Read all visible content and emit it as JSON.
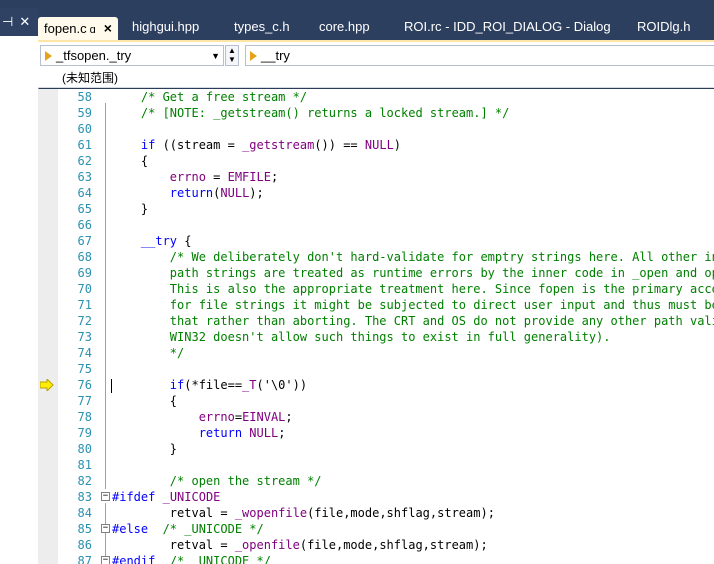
{
  "window": {
    "pin_glyph": "⊣",
    "close_glyph": "✕"
  },
  "tabs": [
    {
      "label": "fopen.c",
      "active": true
    },
    {
      "label": "highgui.hpp"
    },
    {
      "label": "types_c.h"
    },
    {
      "label": "core.hpp"
    },
    {
      "label": "ROI.rc - IDD_ROI_DIALOG - Dialog"
    },
    {
      "label": "ROIDlg.h"
    }
  ],
  "active_tab_close": "×",
  "active_tab_modified": "ɑ",
  "navigation": {
    "scope_combo": "_tfsopen._try",
    "member_combo": "__try"
  },
  "scope_label": "(未知范围)",
  "code_lines": [
    {
      "n": "58",
      "html": "    <span class='c'>/* Get a free stream */</span>"
    },
    {
      "n": "59",
      "html": "    <span class='c'>/* [NOTE: _getstream() returns a locked stream.] */</span>"
    },
    {
      "n": "60",
      "html": ""
    },
    {
      "n": "61",
      "html": "    <span class='k'>if</span> ((stream = <span class='p'>_getstream</span>()) == <span class='p'>NULL</span>)"
    },
    {
      "n": "62",
      "html": "    {"
    },
    {
      "n": "63",
      "html": "        <span class='p'>errno</span> = <span class='p'>EMFILE</span>;"
    },
    {
      "n": "64",
      "html": "        <span class='k'>return</span>(<span class='p'>NULL</span>);"
    },
    {
      "n": "65",
      "html": "    }"
    },
    {
      "n": "66",
      "html": ""
    },
    {
      "n": "67",
      "html": "    <span class='k'>__try</span> {"
    },
    {
      "n": "68",
      "html": "        <span class='c'>/* We deliberately don't hard-validate for emptry strings here. All other inva</span>"
    },
    {
      "n": "69",
      "html": "<span class='c'>        path strings are treated as runtime errors by the inner code in _open and open</span>"
    },
    {
      "n": "70",
      "html": "<span class='c'>        This is also the appropriate treatment here. Since fopen is the primary access</span>"
    },
    {
      "n": "71",
      "html": "<span class='c'>        for file strings it might be subjected to direct user input and thus must be r</span>"
    },
    {
      "n": "72",
      "html": "<span class='c'>        that rather than aborting. The CRT and OS do not provide any other path valida</span>"
    },
    {
      "n": "73",
      "html": "<span class='c'>        WIN32 doesn't allow such things to exist in full generality).</span>"
    },
    {
      "n": "74",
      "html": "<span class='c'>        */</span>"
    },
    {
      "n": "75",
      "html": ""
    },
    {
      "n": "76",
      "html": "        <span class='k'>if</span>(*file==<span class='p'>_T</span>('\\0'))"
    },
    {
      "n": "77",
      "html": "        {"
    },
    {
      "n": "78",
      "html": "            <span class='p'>errno</span>=<span class='p'>EINVAL</span>;"
    },
    {
      "n": "79",
      "html": "            <span class='k'>return</span> <span class='p'>NULL</span>;"
    },
    {
      "n": "80",
      "html": "        }"
    },
    {
      "n": "81",
      "html": ""
    },
    {
      "n": "82",
      "html": "        <span class='c'>/* open the stream */</span>"
    },
    {
      "n": "83",
      "html": "<span class='k'>#ifdef</span> <span class='p'>_UNICODE</span>"
    },
    {
      "n": "84",
      "html": "        retval = <span class='p'>_wopenfile</span>(file,mode,shflag,stream);"
    },
    {
      "n": "85",
      "html": "<span class='k'>#else</span>  <span class='c'>/* _UNICODE */</span>"
    },
    {
      "n": "86",
      "html": "        retval = <span class='p'>_openfile</span>(file,mode,shflag,stream);"
    },
    {
      "n": "87",
      "html": "<span class='k'>#endif</span>  <span class='c'>/* _UNICODE */</span>"
    }
  ],
  "breakpoint_arrow_line": "76",
  "colors": {
    "comment": "#008000",
    "keyword": "#0000ff",
    "macro": "#800080",
    "line_number": "#2b91af",
    "tab_active_bg": "#fffaec",
    "chrome": "#2d3f5e"
  }
}
